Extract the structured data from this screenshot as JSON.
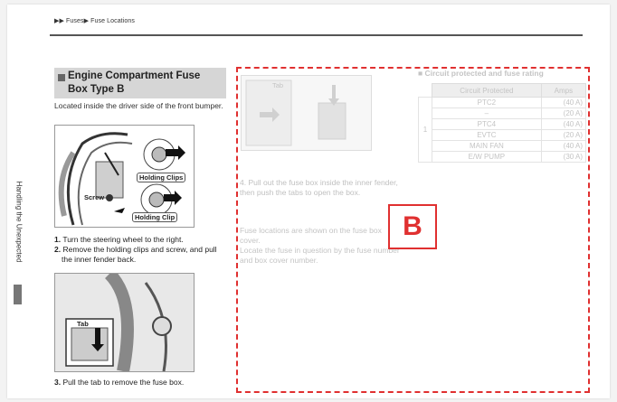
{
  "breadcrumb": "▶▶ Fuses▶ Fuse Locations",
  "side_tab": "Handling the Unexpected",
  "section": {
    "title_line1": "Engine Compartment Fuse",
    "title_line2": "Box Type B",
    "description": "Located inside the driver side of the front bumper."
  },
  "figure1": {
    "callout_top": "Holding Clips",
    "callout_screw": "Screw",
    "callout_bottom": "Holding Clip"
  },
  "steps": [
    {
      "num": "1.",
      "text": "Turn the steering wheel to the right."
    },
    {
      "num": "2.",
      "text": "Remove the holding clips and screw, and pull the inner fender back."
    },
    {
      "num": "3.",
      "text": "Pull the tab to remove the fuse box."
    }
  ],
  "figure2": {
    "callout_tab": "Tab"
  },
  "faded": {
    "figure_tab": "Tab",
    "step4_num": "4.",
    "step4_text": "Pull out the fuse box inside the inner fender, then push the tabs to open the box.",
    "note1": "Fuse locations are shown on the fuse box cover.",
    "note2": "Locate the fuse in question by the fuse number and box cover number."
  },
  "fuse_table": {
    "title": "Circuit protected and fuse rating",
    "headers": [
      "Circuit Protected",
      "Amps"
    ],
    "group_label": "1",
    "rows": [
      {
        "circuit": "PTC2",
        "amps": "(40 A)"
      },
      {
        "circuit": "–",
        "amps": "(20 A)"
      },
      {
        "circuit": "PTC4",
        "amps": "(40 A)"
      },
      {
        "circuit": "EVTC",
        "amps": "(20 A)"
      },
      {
        "circuit": "MAIN FAN",
        "amps": "(40 A)"
      },
      {
        "circuit": "E/W PUMP",
        "amps": "(30 A)"
      }
    ]
  },
  "highlight_label": "B",
  "colors": {
    "highlight": "#e03030",
    "heading_bg": "#d6d6d6",
    "side_mark": "#777777"
  }
}
